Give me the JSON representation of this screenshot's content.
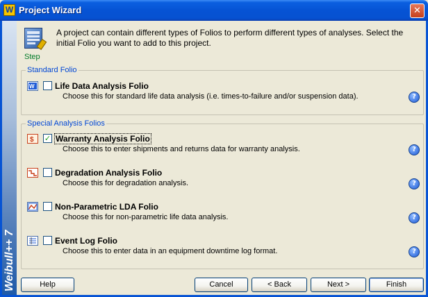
{
  "window": {
    "title": "Project Wizard",
    "app_icon_letter": "W",
    "close_glyph": "✕",
    "side_banner_text": "Weibull++ 7"
  },
  "header": {
    "step_label": "Step",
    "description": "A project can contain different types of Folios to perform different types of analyses. Select the initial Folio you want to add to this project."
  },
  "standard_group": {
    "legend": "Standard Folio",
    "items": [
      {
        "title": "Life Data Analysis Folio",
        "description": "Choose this for standard life data analysis (i.e. times-to-failure and/or suspension data).",
        "checked": false,
        "icon": "life-data-icon"
      }
    ]
  },
  "special_group": {
    "legend": "Special Analysis Folios",
    "items": [
      {
        "title": "Warranty Analysis Folio",
        "description": "Choose this to enter shipments and returns data for warranty analysis.",
        "checked": true,
        "icon": "warranty-icon"
      },
      {
        "title": "Degradation Analysis Folio",
        "description": "Choose this for degradation analysis.",
        "checked": false,
        "icon": "degradation-icon"
      },
      {
        "title": "Non-Parametric LDA Folio",
        "description": "Choose this for non-parametric life data analysis.",
        "checked": false,
        "icon": "non-parametric-icon"
      },
      {
        "title": "Event Log Folio",
        "description": "Choose this to enter data in an equipment downtime log format.",
        "checked": false,
        "icon": "event-log-icon"
      }
    ]
  },
  "check_glyph": "✓",
  "help_glyph": "?",
  "buttons": {
    "help": "Help",
    "cancel": "Cancel",
    "back": "< Back",
    "next": "Next >",
    "finish": "Finish"
  },
  "colors": {
    "titlebar": "#0653d4",
    "group_legend": "#0046d5",
    "step_label": "#007a28"
  }
}
